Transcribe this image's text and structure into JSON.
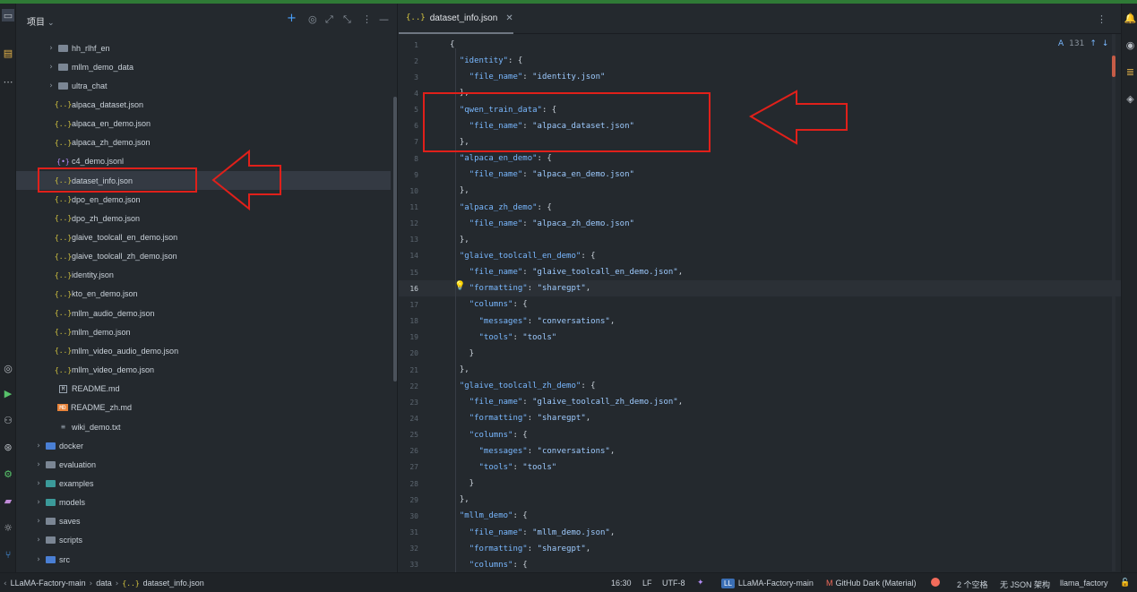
{
  "panel": {
    "title": "项目",
    "tree": [
      {
        "label": "hh_rlhf_en",
        "type": "folder",
        "expandable": true
      },
      {
        "label": "mllm_demo_data",
        "type": "folder",
        "expandable": true
      },
      {
        "label": "ultra_chat",
        "type": "folder",
        "expandable": true
      },
      {
        "label": "alpaca_dataset.json",
        "type": "json"
      },
      {
        "label": "alpaca_en_demo.json",
        "type": "json"
      },
      {
        "label": "alpaca_zh_demo.json",
        "type": "json"
      },
      {
        "label": "c4_demo.jsonl",
        "type": "jsonl"
      },
      {
        "label": "dataset_info.json",
        "type": "json",
        "selected": true
      },
      {
        "label": "dpo_en_demo.json",
        "type": "json"
      },
      {
        "label": "dpo_zh_demo.json",
        "type": "json"
      },
      {
        "label": "glaive_toolcall_en_demo.json",
        "type": "json"
      },
      {
        "label": "glaive_toolcall_zh_demo.json",
        "type": "json"
      },
      {
        "label": "identity.json",
        "type": "json"
      },
      {
        "label": "kto_en_demo.json",
        "type": "json"
      },
      {
        "label": "mllm_audio_demo.json",
        "type": "json"
      },
      {
        "label": "mllm_demo.json",
        "type": "json"
      },
      {
        "label": "mllm_video_audio_demo.json",
        "type": "json"
      },
      {
        "label": "mllm_video_demo.json",
        "type": "json"
      },
      {
        "label": "README.md",
        "type": "md"
      },
      {
        "label": "README_zh.md",
        "type": "mdz"
      },
      {
        "label": "wiki_demo.txt",
        "type": "txt"
      },
      {
        "label": "docker",
        "type": "folder-blue",
        "expandable": true,
        "top": true
      },
      {
        "label": "evaluation",
        "type": "folder",
        "expandable": true,
        "top": true
      },
      {
        "label": "examples",
        "type": "folder-teal",
        "expandable": true,
        "top": true
      },
      {
        "label": "models",
        "type": "folder-teal",
        "expandable": true,
        "top": true
      },
      {
        "label": "saves",
        "type": "folder",
        "expandable": true,
        "top": true
      },
      {
        "label": "scripts",
        "type": "folder",
        "expandable": true,
        "top": true
      },
      {
        "label": "src",
        "type": "folder-blue",
        "expandable": true,
        "top": true
      }
    ]
  },
  "editor": {
    "tab_label": "dataset_info.json",
    "inspection_count": "131",
    "current_line": 16,
    "lines": [
      {
        "n": "1",
        "t": "{"
      },
      {
        "n": "2",
        "t": "  \"identity\": {"
      },
      {
        "n": "3",
        "t": "    \"file_name\": \"identity.json\""
      },
      {
        "n": "4",
        "t": "  },"
      },
      {
        "n": "5",
        "t": "  \"qwen_train_data\": {"
      },
      {
        "n": "6",
        "t": "    \"file_name\": \"alpaca_dataset.json\""
      },
      {
        "n": "7",
        "t": "  },"
      },
      {
        "n": "8",
        "t": "  \"alpaca_en_demo\": {"
      },
      {
        "n": "9",
        "t": "    \"file_name\": \"alpaca_en_demo.json\""
      },
      {
        "n": "10",
        "t": "  },"
      },
      {
        "n": "11",
        "t": "  \"alpaca_zh_demo\": {"
      },
      {
        "n": "12",
        "t": "    \"file_name\": \"alpaca_zh_demo.json\""
      },
      {
        "n": "13",
        "t": "  },"
      },
      {
        "n": "14",
        "t": "  \"glaive_toolcall_en_demo\": {"
      },
      {
        "n": "15",
        "t": "    \"file_name\": \"glaive_toolcall_en_demo.json\","
      },
      {
        "n": "16",
        "t": "    \"formatting\": \"sharegpt\","
      },
      {
        "n": "17",
        "t": "    \"columns\": {"
      },
      {
        "n": "18",
        "t": "      \"messages\": \"conversations\","
      },
      {
        "n": "19",
        "t": "      \"tools\": \"tools\""
      },
      {
        "n": "20",
        "t": "    }"
      },
      {
        "n": "21",
        "t": "  },"
      },
      {
        "n": "22",
        "t": "  \"glaive_toolcall_zh_demo\": {"
      },
      {
        "n": "23",
        "t": "    \"file_name\": \"glaive_toolcall_zh_demo.json\","
      },
      {
        "n": "24",
        "t": "    \"formatting\": \"sharegpt\","
      },
      {
        "n": "25",
        "t": "    \"columns\": {"
      },
      {
        "n": "26",
        "t": "      \"messages\": \"conversations\","
      },
      {
        "n": "27",
        "t": "      \"tools\": \"tools\""
      },
      {
        "n": "28",
        "t": "    }"
      },
      {
        "n": "29",
        "t": "  },"
      },
      {
        "n": "30",
        "t": "  \"mllm_demo\": {"
      },
      {
        "n": "31",
        "t": "    \"file_name\": \"mllm_demo.json\","
      },
      {
        "n": "32",
        "t": "    \"formatting\": \"sharegpt\","
      },
      {
        "n": "33",
        "t": "    \"columns\": {"
      }
    ]
  },
  "statusbar": {
    "breadcrumb": [
      "LLaMA-Factory-main",
      "data",
      "dataset_info.json"
    ],
    "position": "16:30",
    "line_ending": "LF",
    "encoding": "UTF-8",
    "project_badge": "LL",
    "project_name": "LLaMA-Factory-main",
    "theme": "GitHub Dark (Material)",
    "indent": "2 个空格",
    "schema": "无 JSON 架构",
    "interpreter": "llama_factory"
  },
  "colors": {
    "annotation_red": "#e0201a",
    "selection": "#343a43",
    "key": "#79b8ff",
    "string": "#9ecbff"
  }
}
